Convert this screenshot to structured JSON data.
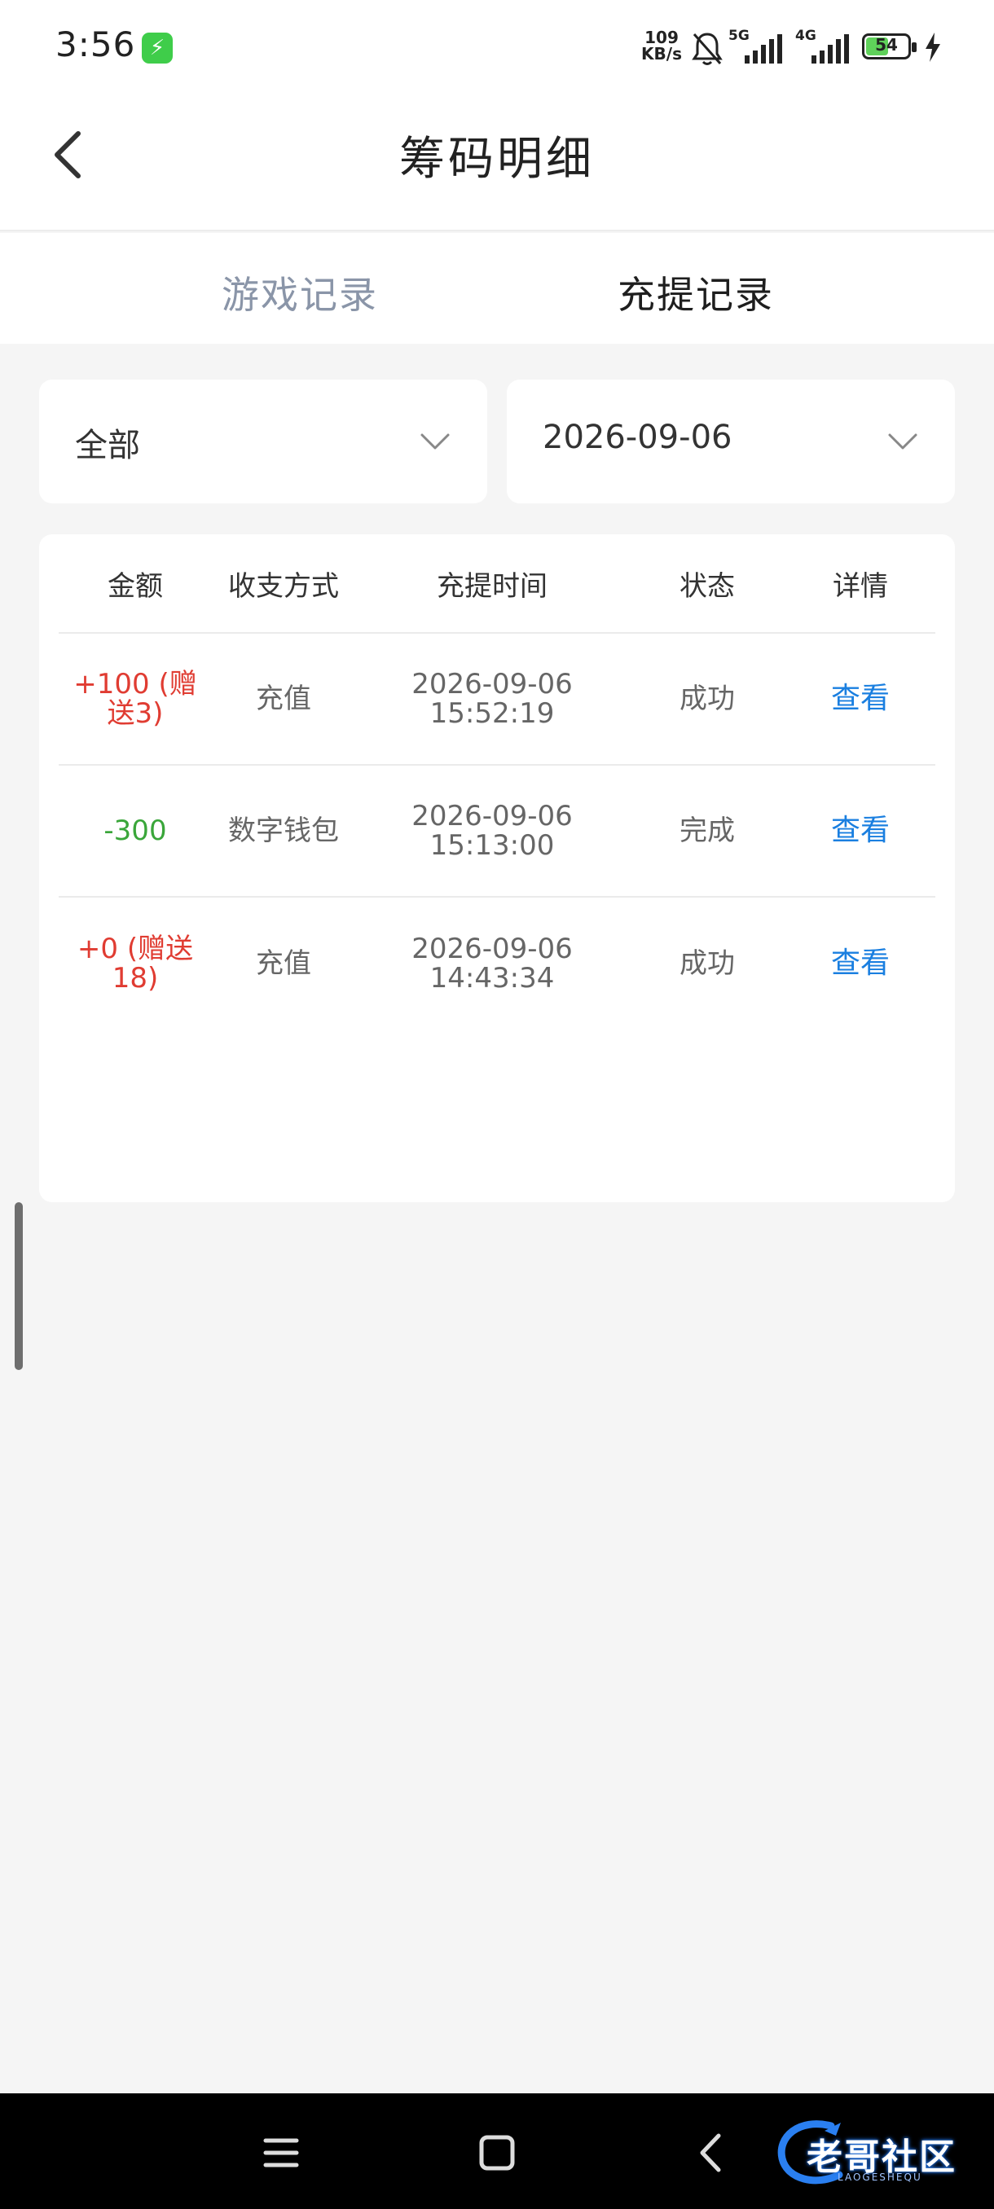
{
  "status_bar": {
    "time": "3:56",
    "net_speed_value": "109",
    "net_speed_unit": "KB/s",
    "net1": "5G",
    "net2": "4G",
    "battery": "54",
    "battery_level": 0.54
  },
  "header": {
    "title": "筹码明细"
  },
  "tabs": [
    {
      "label": "游戏记录",
      "active": false
    },
    {
      "label": "充提记录",
      "active": true
    }
  ],
  "filters": {
    "type": "全部",
    "date": "2026-09-06"
  },
  "table": {
    "headers": [
      "金额",
      "收支方式",
      "充提时间",
      "状态",
      "详情"
    ],
    "rows": [
      {
        "amount": "+100 (赠送3)",
        "method": "充值",
        "date": "2026-09-06",
        "time": "15:52:19",
        "status": "成功",
        "detail": "查看"
      },
      {
        "amount": "-300",
        "method": "数字钱包",
        "date": "2026-09-06",
        "time": "15:13:00",
        "status": "完成",
        "detail": "查看"
      },
      {
        "amount": "+0 (赠送18)",
        "method": "充值",
        "date": "2026-09-06",
        "time": "14:43:34",
        "status": "成功",
        "detail": "查看"
      }
    ]
  },
  "watermark": {
    "text": "老哥社区",
    "sub": "LAOGESHEQU"
  },
  "colors": {
    "positive": "#e03c32",
    "negative": "#3aa63a",
    "link": "#1a7fe0",
    "inactive_tab": "#8a95a8"
  }
}
